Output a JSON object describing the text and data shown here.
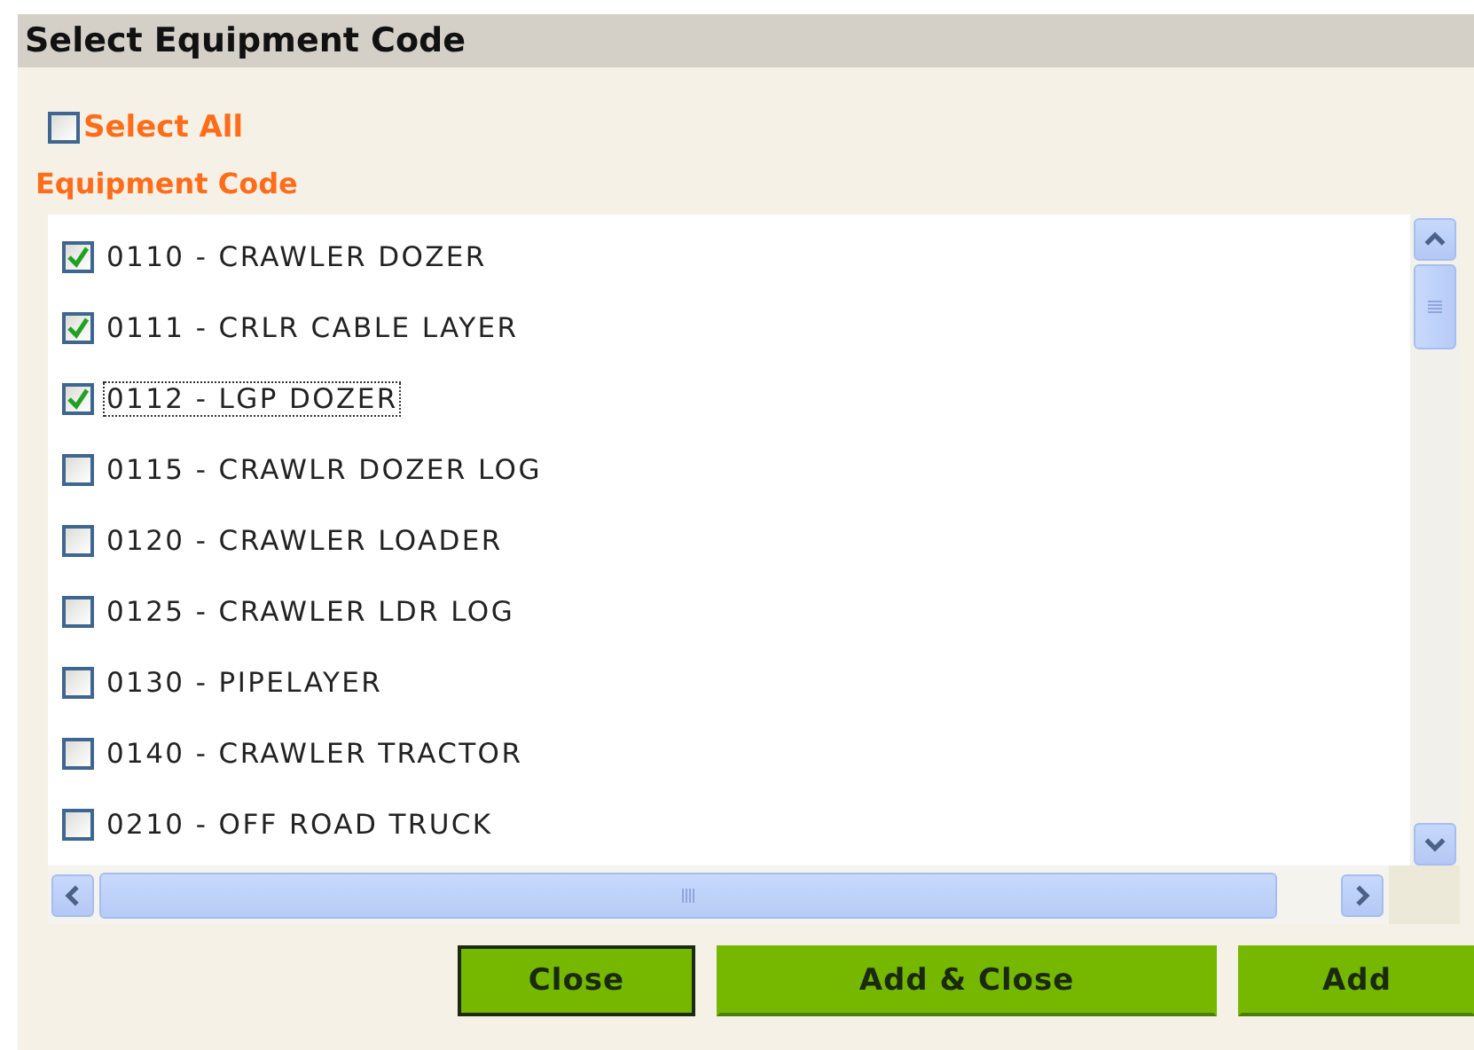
{
  "dialog": {
    "title": "Select Equipment Code"
  },
  "select_all": {
    "label": "Select All",
    "checked": false
  },
  "list_label": "Equipment Code",
  "items": [
    {
      "label": "0110 - CRAWLER DOZER",
      "checked": true,
      "focused": false
    },
    {
      "label": "0111 - CRLR CABLE LAYER",
      "checked": true,
      "focused": false
    },
    {
      "label": "0112 - LGP DOZER",
      "checked": true,
      "focused": true
    },
    {
      "label": "0115 - CRAWLR DOZER LOG",
      "checked": false,
      "focused": false
    },
    {
      "label": "0120 - CRAWLER LOADER",
      "checked": false,
      "focused": false
    },
    {
      "label": "0125 - CRAWLER LDR LOG",
      "checked": false,
      "focused": false
    },
    {
      "label": "0130 - PIPELAYER",
      "checked": false,
      "focused": false
    },
    {
      "label": "0140 - CRAWLER TRACTOR",
      "checked": false,
      "focused": false
    },
    {
      "label": "0210 - OFF ROAD TRUCK",
      "checked": false,
      "focused": false
    }
  ],
  "buttons": [
    {
      "label": "Close",
      "focused": true
    },
    {
      "label": "Add & Close",
      "focused": false
    },
    {
      "label": "Add",
      "focused": false
    }
  ]
}
